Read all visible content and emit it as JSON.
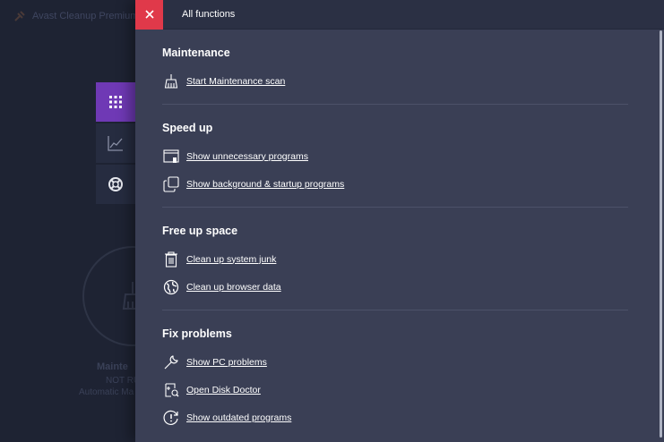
{
  "app": {
    "title": "Avast Cleanup Premium",
    "logo_icon": "broom-logo-icon",
    "sidebar_tools": [
      {
        "name": "all-functions-grid",
        "icon": "grid-icon",
        "active": true
      },
      {
        "name": "performance-chart",
        "icon": "chart-icon",
        "active": false
      },
      {
        "name": "help-support",
        "icon": "lifebuoy-icon",
        "active": false
      }
    ],
    "background_status": {
      "title": "Mainte",
      "subtitle": "NOT RU",
      "note": "Automatic Ma"
    }
  },
  "panel": {
    "title": "All functions",
    "close_icon": "close-icon",
    "accent_color": "#e0394a",
    "sections": [
      {
        "title": "Maintenance",
        "items": [
          {
            "label": "Start Maintenance scan",
            "icon": "broom-icon"
          }
        ]
      },
      {
        "title": "Speed up",
        "items": [
          {
            "label": "Show unnecessary programs",
            "icon": "window-trash-icon"
          },
          {
            "label": "Show background & startup programs",
            "icon": "overlapping-windows-icon"
          }
        ]
      },
      {
        "title": "Free up space",
        "items": [
          {
            "label": "Clean up system junk",
            "icon": "trash-icon"
          },
          {
            "label": "Clean up browser data",
            "icon": "globe-icon"
          }
        ]
      },
      {
        "title": "Fix problems",
        "items": [
          {
            "label": "Show PC problems",
            "icon": "wrench-icon"
          },
          {
            "label": "Open Disk Doctor",
            "icon": "disk-doctor-icon"
          },
          {
            "label": "Show outdated programs",
            "icon": "clock-alert-icon"
          }
        ]
      }
    ]
  }
}
